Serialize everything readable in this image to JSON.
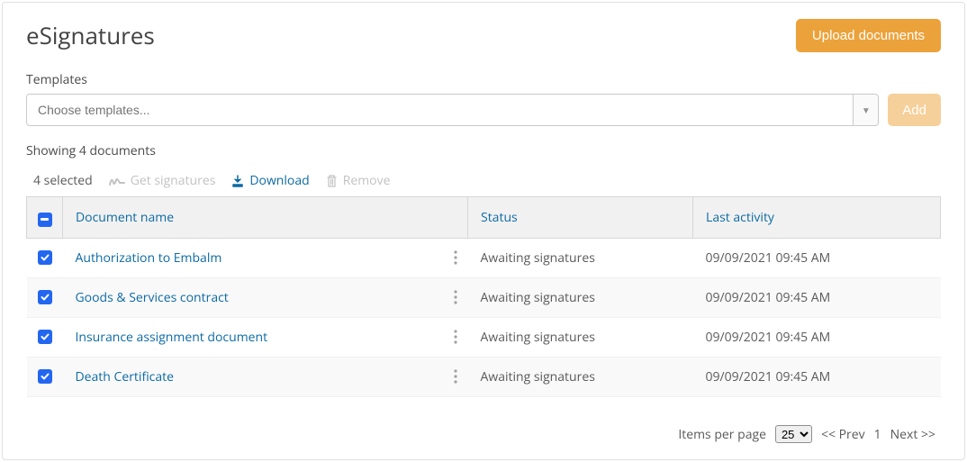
{
  "title": "eSignatures",
  "upload_button": "Upload documents",
  "templates": {
    "label": "Templates",
    "placeholder": "Choose templates...",
    "add_button": "Add"
  },
  "showing_text": "Showing 4 documents",
  "toolbar": {
    "selected_text": "4 selected",
    "get_signatures": "Get signatures",
    "download": "Download",
    "remove": "Remove"
  },
  "columns": {
    "name": "Document name",
    "status": "Status",
    "activity": "Last activity"
  },
  "rows": [
    {
      "name": "Authorization to Embalm",
      "status": "Awaiting signatures",
      "activity": "09/09/2021 09:45 AM"
    },
    {
      "name": "Goods & Services contract",
      "status": "Awaiting signatures",
      "activity": "09/09/2021 09:45 AM"
    },
    {
      "name": "Insurance assignment document",
      "status": "Awaiting signatures",
      "activity": "09/09/2021 09:45 AM"
    },
    {
      "name": "Death Certificate",
      "status": "Awaiting signatures",
      "activity": "09/09/2021 09:45 AM"
    }
  ],
  "footer": {
    "items_per_page_label": "Items per page",
    "items_per_page_value": "25",
    "prev": "<< Prev",
    "page": "1",
    "next": "Next >>"
  }
}
